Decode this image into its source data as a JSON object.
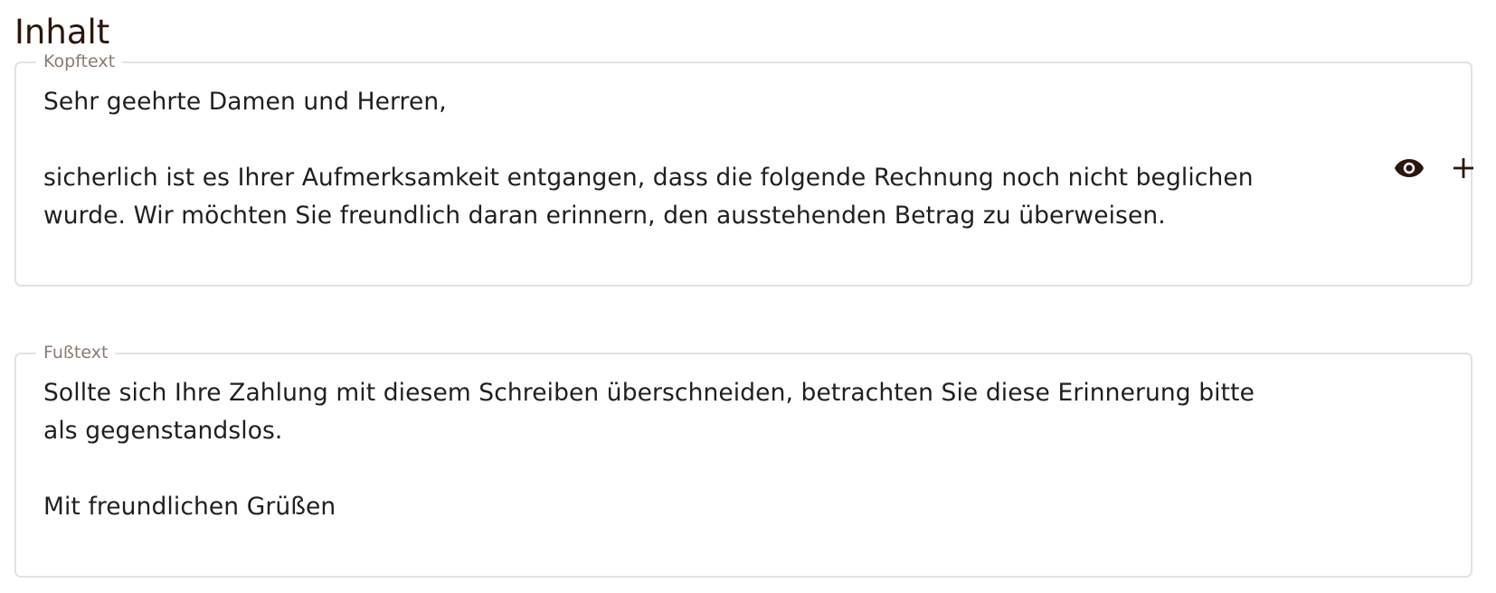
{
  "section": {
    "title": "Inhalt"
  },
  "header_text": {
    "legend": "Kopftext",
    "value": "Sehr geehrte Damen und Herren,\n\nsicherlich ist es Ihrer Aufmerksamkeit entgangen, dass die folgende Rechnung noch nicht beglichen\nwurde. Wir möchten Sie freundlich daran erinnern, den ausstehenden Betrag zu überweisen.",
    "actions": [
      {
        "icon": "eye-icon"
      },
      {
        "icon": "plus-icon"
      }
    ]
  },
  "footer_text": {
    "legend": "Fußtext",
    "value": "Sollte sich Ihre Zahlung mit diesem Schreiben überschneiden, betrachten Sie diese Erinnerung bitte\nals gegenstandslos.\n\nMit freundlichen Grüßen"
  },
  "colors": {
    "title": "#2b160c",
    "icon": "#2b160c",
    "border": "#e2e2e2",
    "legend": "#8a7a72",
    "text": "#1f1f1f"
  }
}
